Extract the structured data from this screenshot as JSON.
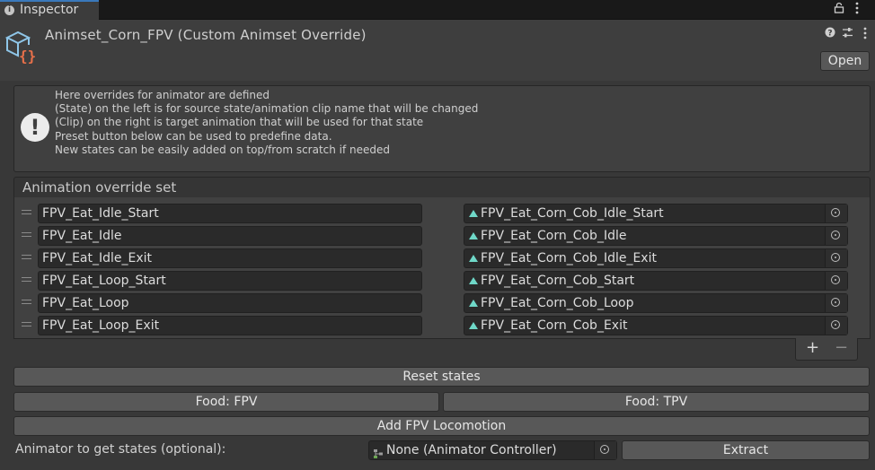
{
  "tab": {
    "title": "Inspector",
    "info_icon": "info-icon"
  },
  "toolbar_icons": [
    "lock-icon",
    "kebab-menu-icon"
  ],
  "header": {
    "title": "Animset_Corn_FPV (Custom Animset Override)",
    "open_label": "Open",
    "icons": [
      "help-icon",
      "presets-icon",
      "kebab-menu-icon"
    ]
  },
  "help": {
    "lines": [
      "Here overrides for animator are defined",
      "(State) on the left is for source state/animation clip name that will be changed",
      "(Clip) on the right is target animation that will be used for that state",
      "Preset button below can be used to predefine data.",
      "New states can be easily added on top/from scratch if needed"
    ]
  },
  "override_list": {
    "title": "Animation override set",
    "rows": [
      {
        "state": "FPV_Eat_Idle_Start",
        "clip": "FPV_Eat_Corn_Cob_Idle_Start"
      },
      {
        "state": "FPV_Eat_Idle",
        "clip": "FPV_Eat_Corn_Cob_Idle"
      },
      {
        "state": "FPV_Eat_Idle_Exit",
        "clip": "FPV_Eat_Corn_Cob_Idle_Exit"
      },
      {
        "state": "FPV_Eat_Loop_Start",
        "clip": "FPV_Eat_Corn_Cob_Start"
      },
      {
        "state": "FPV_Eat_Loop",
        "clip": "FPV_Eat_Corn_Cob_Loop"
      },
      {
        "state": "FPV_Eat_Loop_Exit",
        "clip": "FPV_Eat_Corn_Cob_Exit"
      }
    ],
    "add_label": "+",
    "remove_label": "−"
  },
  "buttons": {
    "reset_states": "Reset states",
    "food_fpv": "Food: FPV",
    "food_tpv": "Food: TPV",
    "add_locomotion": "Add FPV Locomotion",
    "extract": "Extract"
  },
  "animator_field": {
    "label": "Animator to get states (optional):",
    "value": "None (Animator Controller)"
  },
  "colors": {
    "tab_accent": "#3a79bb",
    "clip_icon": "#6fd8c8",
    "asset_icon_cube": "#8fc6e8",
    "asset_icon_braces": "#e8704a"
  }
}
